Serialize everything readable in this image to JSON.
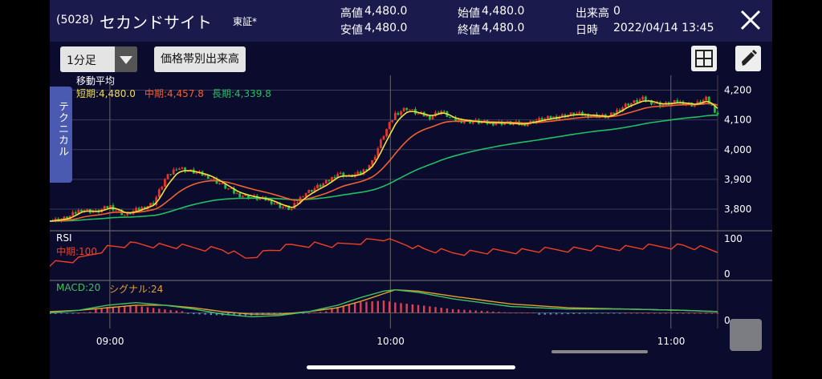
{
  "header": {
    "code": "(5028)",
    "name": "セカンドサイト",
    "market": "東証*",
    "quotes": [
      {
        "label": "高値",
        "value": "4,480.0"
      },
      {
        "label": "始値",
        "value": "4,480.0"
      },
      {
        "label": "出来高",
        "value": "0"
      },
      {
        "label": "安値",
        "value": "4,480.0"
      },
      {
        "label": "終値",
        "value": "4,480.0"
      },
      {
        "label": "日時",
        "value": "2022/04/14 13:45"
      }
    ]
  },
  "toolbar": {
    "timeframe": "1分足",
    "volume_button": "価格帯別出来高",
    "grid_icon": "grid-icon",
    "pen_icon": "pen-icon"
  },
  "side_tab": {
    "label": "テクニカル"
  },
  "indicators": {
    "ma_title": "移動平均",
    "ma_short": "短期:4,480.0",
    "ma_mid": "中期:4,457.8",
    "ma_long": "長期:4,339.8",
    "rsi_title": "RSI",
    "rsi_mid": "中期:100",
    "macd_label": "MACD:20",
    "signal_label": "シグナル:24"
  },
  "colors": {
    "up": "#e8352a",
    "down": "#18c040",
    "ma_short": "#f0e040",
    "ma_mid": "#f06030",
    "ma_long": "#20c060",
    "rsi": "#f04020",
    "macd": "#40c060",
    "signal": "#e0a030",
    "hist_pos": "#e04050",
    "hist_neg": "#4090d0"
  },
  "chart_data": {
    "type": "candlestick",
    "price_axis": {
      "ticks": [
        "4,200",
        "4,100",
        "4,000",
        "3,900",
        "3,800"
      ],
      "values": [
        4200,
        4100,
        4000,
        3900,
        3800
      ],
      "ylim": [
        3730,
        4250
      ]
    },
    "rsi_axis": {
      "ticks": [
        "100",
        "0"
      ],
      "values": [
        100,
        0
      ]
    },
    "macd_axis": {
      "ticks": [
        "0"
      ],
      "values": [
        0
      ]
    },
    "time_axis": {
      "ticks": [
        "09:00",
        "10:00",
        "11:00"
      ],
      "positions": [
        0.09,
        0.51,
        0.93
      ]
    },
    "price_path": [
      [
        0,
        3760
      ],
      [
        6,
        3770
      ],
      [
        11,
        3800
      ],
      [
        16,
        3790
      ],
      [
        21,
        3810
      ],
      [
        26,
        3780
      ],
      [
        31,
        3800
      ],
      [
        36,
        3820
      ],
      [
        40,
        3900
      ],
      [
        44,
        3940
      ],
      [
        48,
        3930
      ],
      [
        55,
        3910
      ],
      [
        60,
        3880
      ],
      [
        65,
        3850
      ],
      [
        70,
        3840
      ],
      [
        76,
        3830
      ],
      [
        80,
        3810
      ],
      [
        84,
        3800
      ],
      [
        88,
        3850
      ],
      [
        92,
        3870
      ],
      [
        96,
        3890
      ],
      [
        100,
        3920
      ],
      [
        104,
        3910
      ],
      [
        108,
        3920
      ],
      [
        112,
        3960
      ],
      [
        116,
        4050
      ],
      [
        120,
        4120
      ],
      [
        124,
        4140
      ],
      [
        128,
        4120
      ],
      [
        132,
        4110
      ],
      [
        136,
        4130
      ],
      [
        140,
        4100
      ],
      [
        146,
        4095
      ],
      [
        152,
        4090
      ],
      [
        158,
        4090
      ],
      [
        164,
        4085
      ],
      [
        170,
        4100
      ],
      [
        176,
        4110
      ],
      [
        182,
        4120
      ],
      [
        188,
        4115
      ],
      [
        194,
        4110
      ],
      [
        200,
        4150
      ],
      [
        206,
        4170
      ],
      [
        212,
        4150
      ],
      [
        218,
        4160
      ],
      [
        224,
        4150
      ],
      [
        228,
        4170
      ],
      [
        232,
        4120
      ]
    ],
    "rsi_path": [
      [
        0,
        30
      ],
      [
        10,
        40
      ],
      [
        20,
        75
      ],
      [
        30,
        85
      ],
      [
        40,
        80
      ],
      [
        50,
        75
      ],
      [
        60,
        70
      ],
      [
        68,
        45
      ],
      [
        76,
        65
      ],
      [
        84,
        80
      ],
      [
        92,
        85
      ],
      [
        100,
        80
      ],
      [
        110,
        95
      ],
      [
        116,
        100
      ],
      [
        120,
        90
      ],
      [
        124,
        85
      ],
      [
        130,
        70
      ],
      [
        140,
        60
      ],
      [
        160,
        65
      ],
      [
        180,
        70
      ],
      [
        200,
        75
      ],
      [
        220,
        80
      ],
      [
        232,
        65
      ]
    ],
    "macd_path": [
      [
        0,
        0
      ],
      [
        10,
        2
      ],
      [
        20,
        6
      ],
      [
        30,
        8
      ],
      [
        40,
        6
      ],
      [
        50,
        3
      ],
      [
        60,
        -1
      ],
      [
        70,
        -3
      ],
      [
        80,
        -2
      ],
      [
        90,
        1
      ],
      [
        100,
        6
      ],
      [
        108,
        12
      ],
      [
        116,
        17
      ],
      [
        120,
        18
      ],
      [
        128,
        16
      ],
      [
        140,
        11
      ],
      [
        160,
        5
      ],
      [
        180,
        3
      ],
      [
        200,
        3
      ],
      [
        220,
        2
      ],
      [
        232,
        1
      ]
    ],
    "signal_path": [
      [
        0,
        1
      ],
      [
        10,
        2
      ],
      [
        20,
        4
      ],
      [
        30,
        6
      ],
      [
        40,
        6
      ],
      [
        50,
        4
      ],
      [
        60,
        1
      ],
      [
        70,
        -1
      ],
      [
        80,
        -1
      ],
      [
        90,
        1
      ],
      [
        100,
        4
      ],
      [
        108,
        9
      ],
      [
        116,
        15
      ],
      [
        120,
        18
      ],
      [
        128,
        17
      ],
      [
        140,
        13
      ],
      [
        160,
        7
      ],
      [
        180,
        4
      ],
      [
        200,
        3
      ],
      [
        220,
        2
      ],
      [
        232,
        1
      ]
    ]
  }
}
